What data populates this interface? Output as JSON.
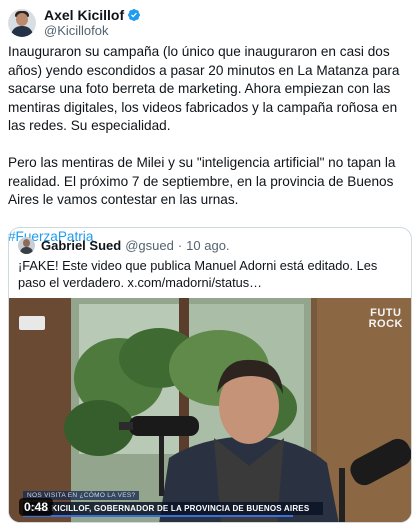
{
  "author": {
    "display_name": "Axel Kicillof",
    "handle": "@Kicillofok",
    "verified": true,
    "verified_color": "#1d9bf0"
  },
  "tweet": {
    "paragraph_1": "Inauguraron su campaña (lo único que inauguraron en casi dos años) yendo escondidos a pasar 20 minutos en La Matanza para sacarse una foto berreta de marketing. Ahora empiezan con las mentiras digitales, los videos fabricados y la campaña roñosa en las redes. Su especialidad.",
    "paragraph_2": "Pero las mentiras de Milei y su \"inteligencia artificial\" no tapan la realidad. El próximo 7 de septiembre, en la provincia de Buenos Aires le vamos contestar en las urnas.",
    "hashtag": "#FuerzaPatria"
  },
  "quoted_tweet": {
    "display_name": "Gabriel Sued",
    "handle": "@gsued",
    "separator": "·",
    "date": "10 ago.",
    "text": "¡FAKE! Este video que publica Manuel Adorni está editado. Les paso el verdadero.  x.com/madorni/status…",
    "video": {
      "brand_line_1": "FUTU",
      "brand_line_2": "ROCK",
      "lower_third_top": "NOS VISITA EN ¿CÓMO LA VES?",
      "lower_third_main": "AXEL KICILLOF, GOBERNADOR DE LA PROVINCIA DE BUENOS AIRES",
      "duration": "0:48"
    }
  }
}
